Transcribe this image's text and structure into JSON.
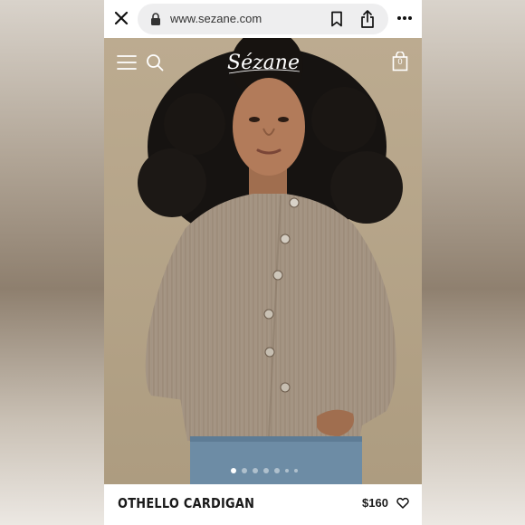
{
  "browser": {
    "url": "www.sezane.com"
  },
  "site": {
    "logo_text": "Sézane",
    "cart_count": "0"
  },
  "product": {
    "name": "OTHELLO CARDIGAN",
    "price": "$160"
  },
  "gallery": {
    "slides": 7,
    "active_index": 0
  },
  "icons": {
    "close": "close-icon",
    "lock": "lock-icon",
    "bookmark": "bookmark-icon",
    "share": "share-icon",
    "more": "more-icon",
    "menu": "menu-icon",
    "search": "search-icon",
    "cart": "bag-icon",
    "wishlist": "heart-icon"
  },
  "colors": {
    "hero_background": "#b4a386",
    "cardigan": "#a79685",
    "url_bar": "#eeeeef",
    "text": "#1a1a1a"
  }
}
